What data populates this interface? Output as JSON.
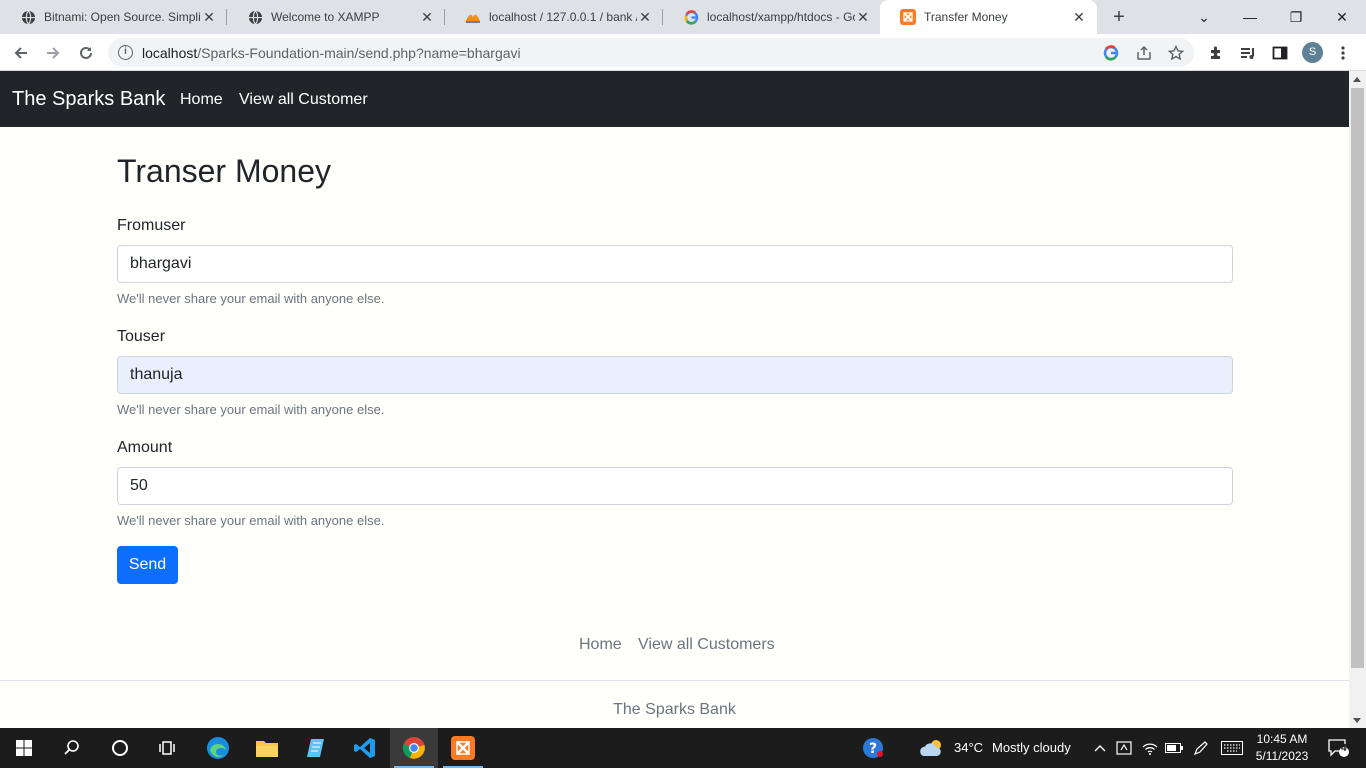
{
  "browser": {
    "tabs": [
      {
        "title": "Bitnami: Open Source. Simplif",
        "icon": "globe-icon"
      },
      {
        "title": "Welcome to XAMPP",
        "icon": "globe-icon"
      },
      {
        "title": "localhost / 127.0.0.1 / bank / ",
        "icon": "phpmyadmin-icon"
      },
      {
        "title": "localhost/xampp/htdocs - Go",
        "icon": "google-icon"
      },
      {
        "title": "Transfer Money",
        "icon": "xampp-icon",
        "active": true
      }
    ],
    "address": {
      "host": "localhost",
      "path": "/Sparks-Foundation-main/send.php?name=bhargavi"
    },
    "profile_initial": "S"
  },
  "navbar": {
    "brand": "The Sparks Bank",
    "links": [
      "Home",
      "View all Customer"
    ]
  },
  "form": {
    "title": "Transer Money",
    "fields": [
      {
        "label": "Fromuser",
        "value": "bhargavi",
        "help": "We'll never share your email with anyone else."
      },
      {
        "label": "Touser",
        "value": "thanuja",
        "help": "We'll never share your email with anyone else."
      },
      {
        "label": "Amount",
        "value": "50",
        "help": "We'll never share your email with anyone else."
      }
    ],
    "submit_label": "Send"
  },
  "footer": {
    "links": [
      "Home",
      "View all Customers"
    ],
    "brand": "The Sparks Bank"
  },
  "taskbar": {
    "weather_temp": "34°C",
    "weather_text": "Mostly cloudy",
    "time": "10:45 AM",
    "date": "5/11/2023",
    "notification_count": "4"
  },
  "colors": {
    "navbar": "#212529",
    "primary_button": "#0d6efd",
    "autofill": "#e8f0fe"
  }
}
